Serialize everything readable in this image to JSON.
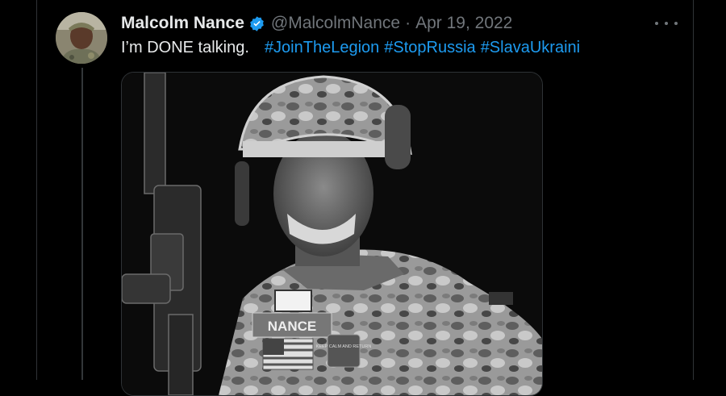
{
  "tweet": {
    "author_name": "Malcolm Nance",
    "verified": true,
    "handle": "@MalcolmNance",
    "separator": "·",
    "date": "Apr 19, 2022",
    "text": "I’m DONE talking.",
    "hashtags": [
      "#JoinTheLegion",
      "#StopRussia",
      "#SlavaUkraini"
    ],
    "more_icon": "more-horizontal-icon",
    "verified_icon": "verified-badge-icon",
    "media_patch_text": "NANCE",
    "media_badge_text": "KEEP CALM AND RETURN"
  },
  "colors": {
    "background": "#000000",
    "text_primary": "#e7e9ea",
    "text_secondary": "#71767b",
    "link": "#1d9bf0",
    "verified": "#1d9bf0",
    "border": "#2f3336"
  }
}
